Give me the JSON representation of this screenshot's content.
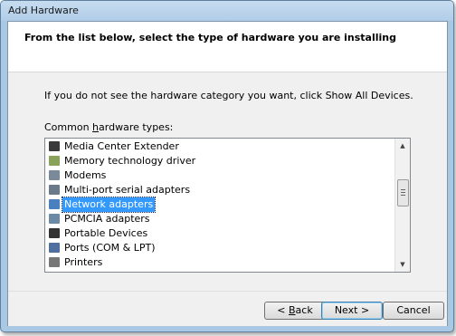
{
  "window": {
    "title": "Add Hardware"
  },
  "header": {
    "text": "From the list below, select the type of hardware you are installing"
  },
  "body": {
    "info": "If you do not see the hardware category you want, click Show All Devices.",
    "list_label_pre": "Common ",
    "list_label_key": "h",
    "list_label_post": "ardware types:"
  },
  "list": {
    "items": [
      {
        "label": "Media Center Extender",
        "icon": "media-center-extender-icon",
        "color": "#3a3a3a"
      },
      {
        "label": "Memory technology driver",
        "icon": "memory-driver-icon",
        "color": "#8aa35a"
      },
      {
        "label": "Modems",
        "icon": "modem-icon",
        "color": "#7a8a9a"
      },
      {
        "label": "Multi-port serial adapters",
        "icon": "serial-adapter-icon",
        "color": "#6a7a8a"
      },
      {
        "label": "Network adapters",
        "icon": "network-adapter-icon",
        "color": "#4a7fc0",
        "selected": true
      },
      {
        "label": "PCMCIA adapters",
        "icon": "pcmcia-adapter-icon",
        "color": "#6b8aa6"
      },
      {
        "label": "Portable Devices",
        "icon": "portable-device-icon",
        "color": "#333333"
      },
      {
        "label": "Ports (COM & LPT)",
        "icon": "port-icon",
        "color": "#4f6f9f"
      },
      {
        "label": "Printers",
        "icon": "printer-icon",
        "color": "#777777"
      }
    ]
  },
  "buttons": {
    "back_pre": "< ",
    "back_key": "B",
    "back_post": "ack",
    "next": "Next >",
    "cancel": "Cancel"
  },
  "colors": {
    "selection": "#3399ff",
    "title_bar": "#b9d3ec"
  }
}
